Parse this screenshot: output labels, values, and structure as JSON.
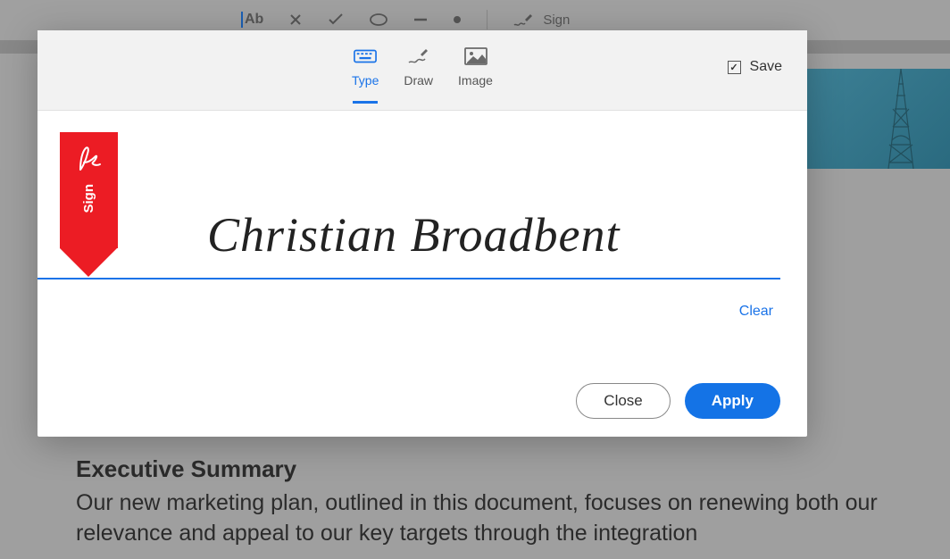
{
  "topToolbar": {
    "ab": "Ab",
    "sign": "Sign"
  },
  "document": {
    "heading": "Executive Summary",
    "text": "Our new marketing plan, outlined in this document, focuses on renewing both our relevance and appeal to our key targets through the integration"
  },
  "dialog": {
    "tabs": {
      "type": "Type",
      "draw": "Draw",
      "image": "Image"
    },
    "save": "Save",
    "badge": "Sign",
    "signature": "Christian Broadbent",
    "clear": "Clear",
    "close": "Close",
    "apply": "Apply"
  }
}
